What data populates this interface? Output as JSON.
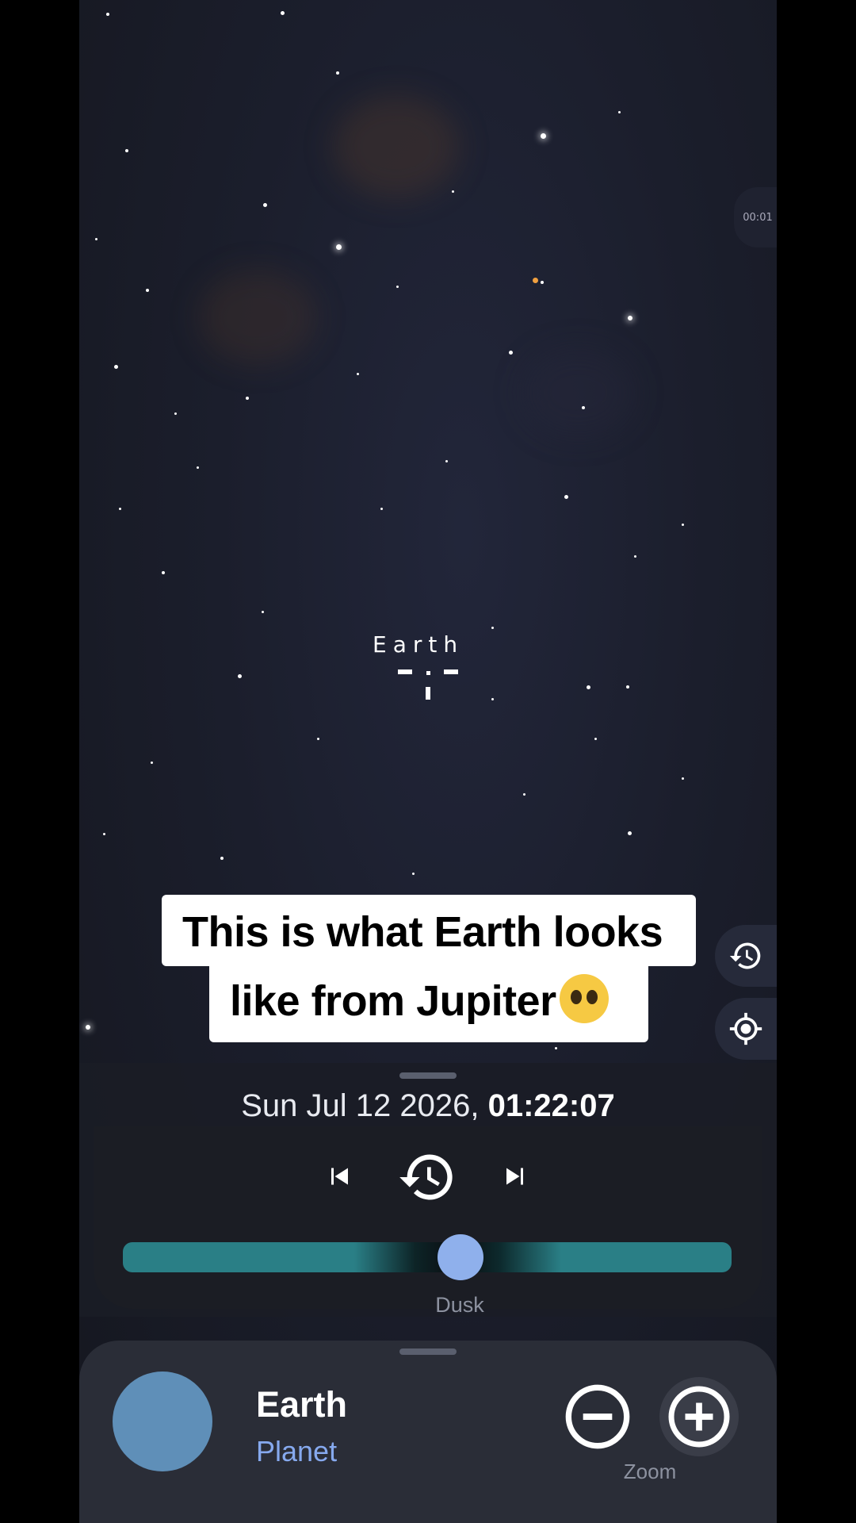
{
  "sky": {
    "target_label": "Earth",
    "timer_badge": "00:01"
  },
  "caption": {
    "line1": "This is what Earth looks",
    "line2": "like from Jupiter"
  },
  "time_panel": {
    "date": "Sun Jul 12 2026,",
    "time": "01:22:07",
    "slider_label": "Dusk",
    "slider_position_fraction": 0.56
  },
  "object": {
    "name": "Earth",
    "type": "Planet"
  },
  "zoom": {
    "label": "Zoom"
  },
  "icons": [
    "history-icon",
    "locate-icon",
    "skip-back-icon",
    "time-reset-icon",
    "skip-forward-icon",
    "zoom-out-icon",
    "zoom-in-icon"
  ],
  "colors": {
    "sky": "#1b1e2c",
    "slider_teal": "#2a7f86",
    "knob": "#8fb0ec",
    "planet": "#5f8fb8",
    "object_type": "#86a9ee"
  }
}
